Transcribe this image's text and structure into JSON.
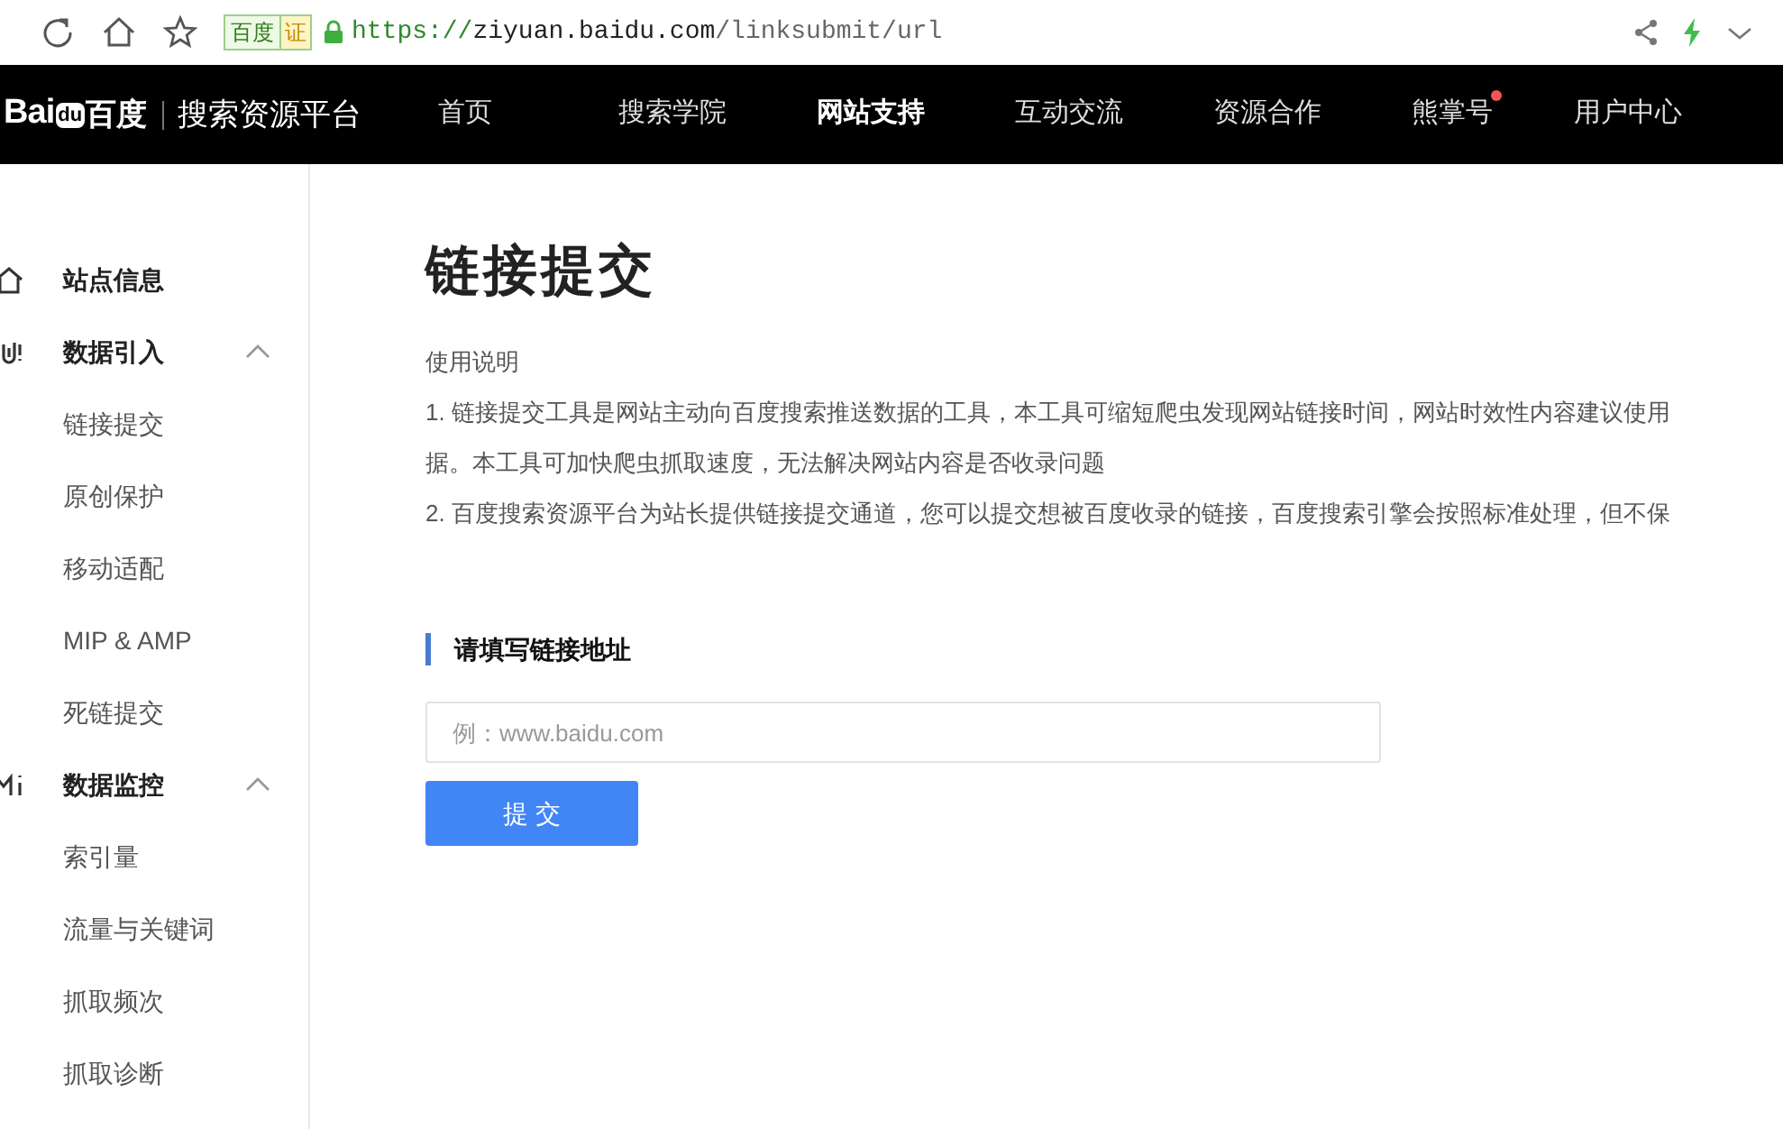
{
  "browser": {
    "badge": "百度",
    "cert": "证",
    "url_scheme": "https://",
    "url_host": "ziyuan.baidu.com",
    "url_path": "/linksubmit/url"
  },
  "header": {
    "logo_mark": "Bai",
    "logo_paw": "du",
    "logo_cn": "百度",
    "platform": "搜索资源平台",
    "nav": [
      {
        "label": "首页",
        "selected": false,
        "dot": false
      },
      {
        "label": "搜索学院",
        "selected": false,
        "dot": false
      },
      {
        "label": "网站支持",
        "selected": true,
        "dot": false
      },
      {
        "label": "互动交流",
        "selected": false,
        "dot": false
      },
      {
        "label": "资源合作",
        "selected": false,
        "dot": false
      },
      {
        "label": "熊掌号",
        "selected": false,
        "dot": true
      },
      {
        "label": "用户中心",
        "selected": false,
        "dot": false
      }
    ]
  },
  "sidebar": [
    {
      "label": "站点信息",
      "kind": "home"
    },
    {
      "label": "数据引入",
      "kind": "link",
      "expanded": true,
      "children": [
        {
          "label": "链接提交"
        },
        {
          "label": "原创保护"
        },
        {
          "label": "移动适配"
        },
        {
          "label": "MIP & AMP"
        },
        {
          "label": "死链提交"
        }
      ]
    },
    {
      "label": "数据监控",
      "kind": "chart",
      "expanded": true,
      "children": [
        {
          "label": "索引量"
        },
        {
          "label": "流量与关键词"
        },
        {
          "label": "抓取频次"
        },
        {
          "label": "抓取诊断"
        }
      ]
    }
  ],
  "main": {
    "title": "链接提交",
    "usage_heading": "使用说明",
    "usage_lines": [
      "1. 链接提交工具是网站主动向百度搜索推送数据的工具，本工具可缩短爬虫发现网站链接时间，网站时效性内容建议使用",
      "据。本工具可加快爬虫抓取速度，无法解决网站内容是否收录问题",
      "2. 百度搜索资源平台为站长提供链接提交通道，您可以提交想被百度收录的链接，百度搜索引擎会按照标准处理，但不保"
    ],
    "section_title": "请填写链接地址",
    "url_field": {
      "placeholder": "例：www.baidu.com"
    },
    "submit": "提 交"
  }
}
